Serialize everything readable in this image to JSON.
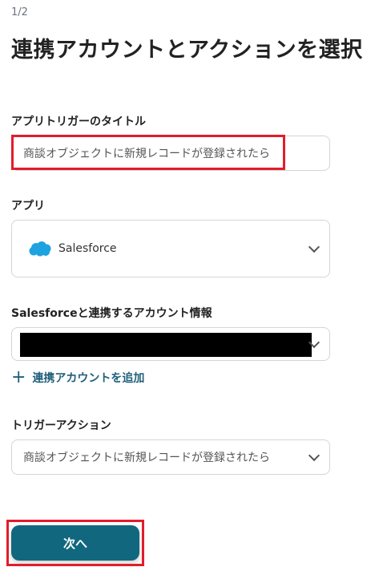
{
  "step": "1/2",
  "title": "連携アカウントとアクションを選択",
  "trigger_title": {
    "label": "アプリトリガーのタイトル",
    "value": "商談オブジェクトに新規レコードが登録されたら"
  },
  "app": {
    "label": "アプリ",
    "selected": "Salesforce",
    "icon": "salesforce-cloud-icon"
  },
  "account": {
    "label": "Salesforceと連携するアカウント情報",
    "add_link": "連携アカウントを追加"
  },
  "trigger_action": {
    "label": "トリガーアクション",
    "selected": "商談オブジェクトに新規レコードが登録されたら"
  },
  "next_button": "次へ",
  "colors": {
    "primary": "#11687e",
    "link": "#1f5f7a",
    "highlight": "#e11d2b",
    "salesforce": "#1ea2e0"
  }
}
